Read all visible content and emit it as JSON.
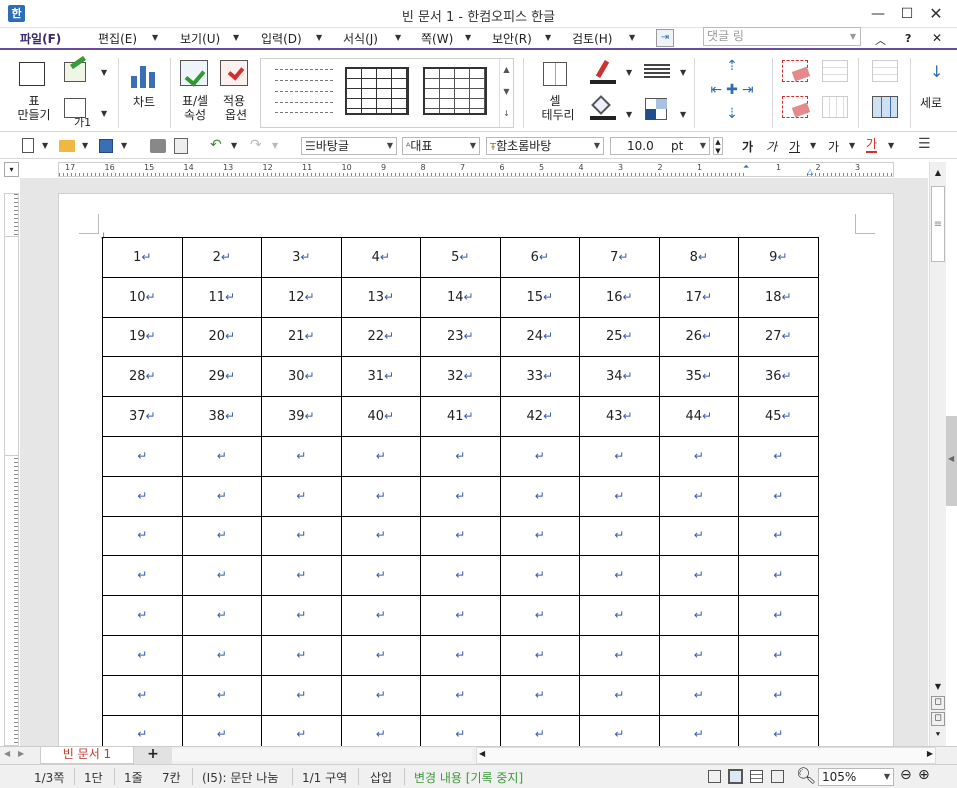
{
  "window": {
    "title": "빈 문서 1 - 한컴오피스 한글",
    "app_icon": "hwp-app-icon"
  },
  "menu": [
    "파일(F)",
    "편집(E)",
    "보기(U)",
    "입력(D)",
    "서식(J)",
    "쪽(W)",
    "보안(R)",
    "검토(H)"
  ],
  "comment_box": {
    "placeholder": "댓글 링"
  },
  "ribbon": {
    "table_make": "표\n만들기",
    "table_make_l1": "표",
    "table_make_l2": "만들기",
    "cell_style": "가1",
    "chart": "차트",
    "table_props_l1": "표/셀",
    "table_props_l2": "속성",
    "apply_l1": "적용",
    "apply_l2": "옵션",
    "cell_border_l1": "셀",
    "cell_border_l2": "테두리",
    "vertical": "세로"
  },
  "toolbar2": {
    "style": "바탕글",
    "lang": "대표",
    "font": "함초롬바탕",
    "size": "10.0",
    "unit": "pt",
    "fmt": [
      "가",
      "가",
      "가",
      "가",
      "가"
    ]
  },
  "table": {
    "rows": [
      [
        "1",
        "2",
        "3",
        "4",
        "5",
        "6",
        "7",
        "8",
        "9"
      ],
      [
        "10",
        "11",
        "12",
        "13",
        "14",
        "15",
        "16",
        "17",
        "18"
      ],
      [
        "19",
        "20",
        "21",
        "22",
        "23",
        "24",
        "25",
        "26",
        "27"
      ],
      [
        "28",
        "29",
        "30",
        "31",
        "32",
        "33",
        "34",
        "35",
        "36"
      ],
      [
        "37",
        "38",
        "39",
        "40",
        "41",
        "42",
        "43",
        "44",
        "45"
      ],
      [
        "",
        "",
        "",
        "",
        "",
        "",
        "",
        "",
        ""
      ],
      [
        "",
        "",
        "",
        "",
        "",
        "",
        "",
        "",
        ""
      ],
      [
        "",
        "",
        "",
        "",
        "",
        "",
        "",
        "",
        ""
      ],
      [
        "",
        "",
        "",
        "",
        "",
        "",
        "",
        "",
        ""
      ],
      [
        "",
        "",
        "",
        "",
        "",
        "",
        "",
        "",
        ""
      ],
      [
        "",
        "",
        "",
        "",
        "",
        "",
        "",
        "",
        ""
      ],
      [
        "",
        "",
        "",
        "",
        "",
        "",
        "",
        "",
        ""
      ],
      [
        "",
        "",
        "",
        "",
        "",
        "",
        "",
        "",
        ""
      ]
    ],
    "return_mark": "↵"
  },
  "tabs": {
    "doc": "빈 문서 1",
    "add": "+"
  },
  "status": {
    "page": "1/3쪽",
    "col": "1단",
    "line": "1줄",
    "cell": "7칸",
    "cellref": "(I5): 문단 나눔",
    "section": "1/1 구역",
    "insert": "삽입",
    "track": "변경 내용 [기록 중지]",
    "zoom": "105%"
  },
  "ruler": {
    "h_ticks": [
      "17",
      "16",
      "15",
      "14",
      "13",
      "12",
      "11",
      "10",
      "9",
      "8",
      "7",
      "6",
      "5",
      "4",
      "3",
      "2",
      "1",
      "",
      "1",
      "2",
      "3"
    ]
  }
}
